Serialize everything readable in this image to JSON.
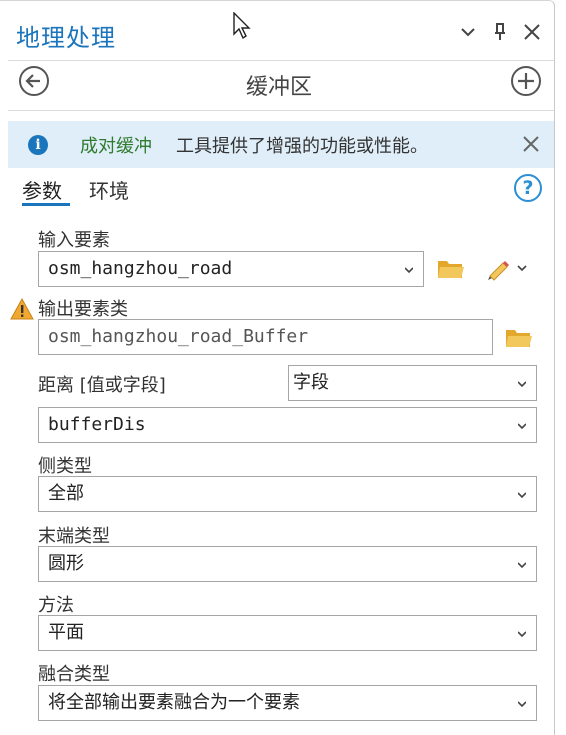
{
  "pane": {
    "title": "地理处理"
  },
  "tool": {
    "title": "缓冲区"
  },
  "info": {
    "link_text": "成对缓冲",
    "message": "工具提供了增强的功能或性能。"
  },
  "tabs": [
    {
      "label": "参数"
    },
    {
      "label": "环境"
    }
  ],
  "params": {
    "input_features": {
      "label": "输入要素",
      "value": "osm_hangzhou_road"
    },
    "output_features": {
      "label": "输出要素类",
      "value": "osm_hangzhou_road_Buffer"
    },
    "distance": {
      "label": "距离 [值或字段]",
      "mode_value": "字段",
      "value": "bufferDis"
    },
    "side_type": {
      "label": "侧类型",
      "value": "全部"
    },
    "end_type": {
      "label": "末端类型",
      "value": "圆形"
    },
    "method": {
      "label": "方法",
      "value": "平面"
    },
    "dissolve_type": {
      "label": "融合类型",
      "value": "将全部输出要素融合为一个要素"
    }
  },
  "colors": {
    "accent": "#1b75bc",
    "link": "#2f7a2f",
    "info_bg": "#dfeef8",
    "folder": "#e3a82b",
    "warning": "#f0a830"
  },
  "icons": [
    "chevron-down-icon",
    "pin-icon",
    "close-icon",
    "back-icon",
    "add-icon",
    "info-icon",
    "help-icon",
    "folder-icon",
    "pencil-icon",
    "warning-icon"
  ]
}
